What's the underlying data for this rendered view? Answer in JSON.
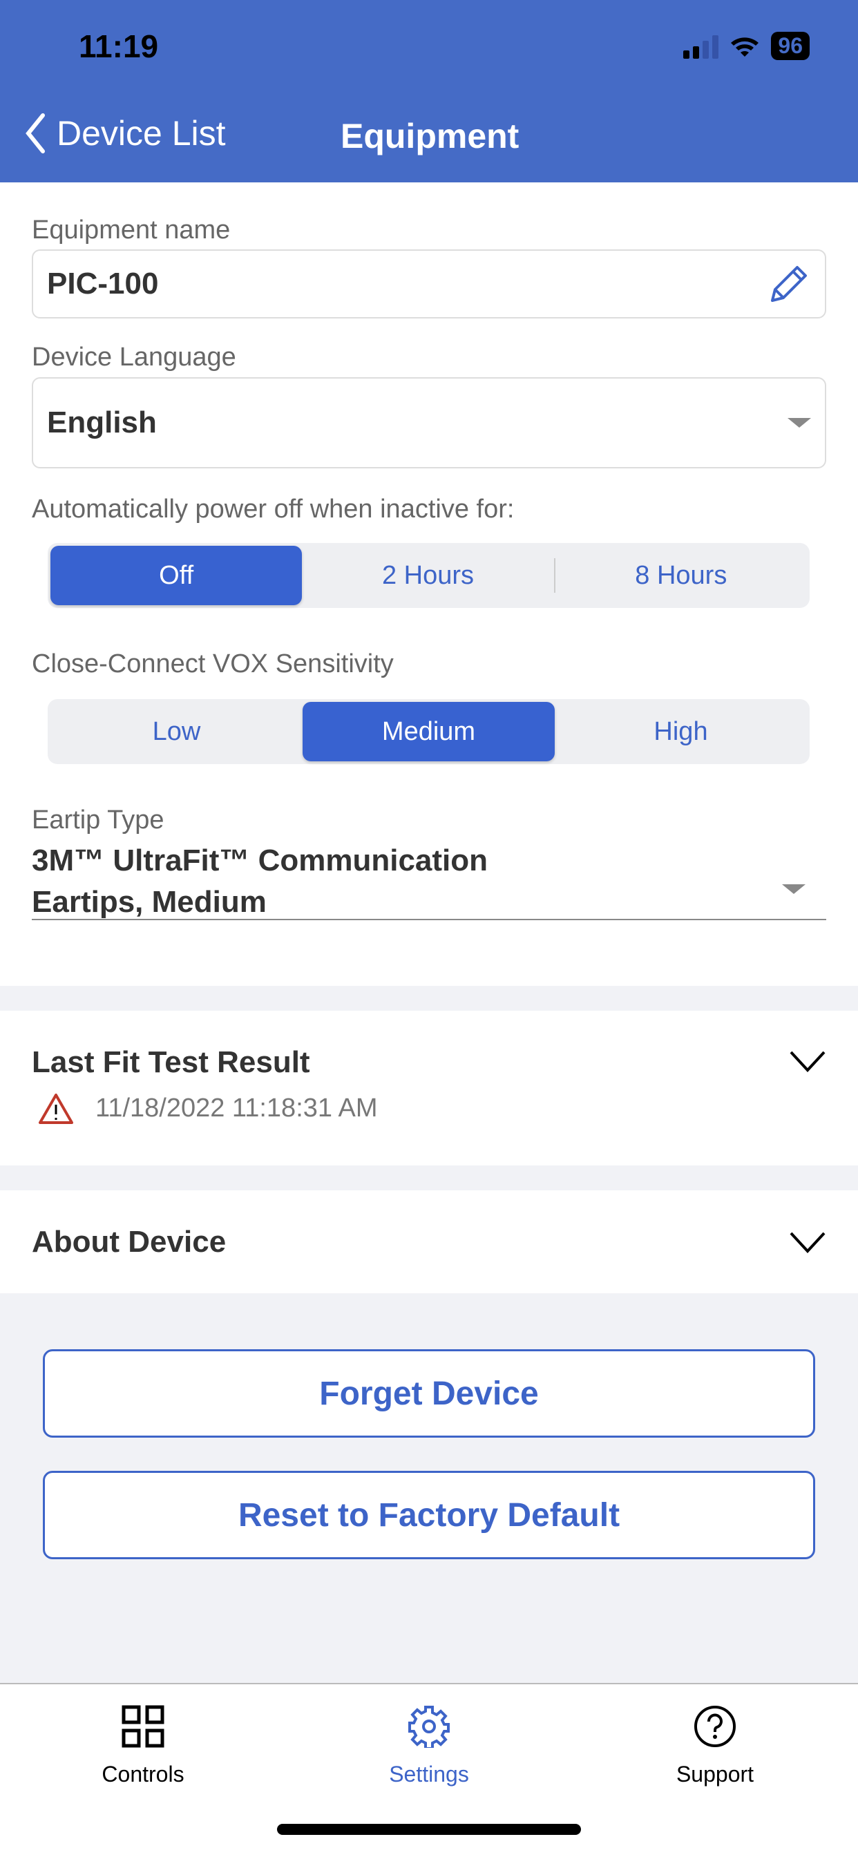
{
  "status_bar": {
    "time": "11:19",
    "battery": "96"
  },
  "nav": {
    "back_label": "Device List",
    "title": "Equipment"
  },
  "equipment_name": {
    "label": "Equipment name",
    "value": "PIC-100"
  },
  "device_language": {
    "label": "Device Language",
    "value": "English"
  },
  "auto_power_off": {
    "label": "Automatically power off when inactive for:",
    "options": [
      "Off",
      "2 Hours",
      "8 Hours"
    ],
    "selected": "Off"
  },
  "vox_sensitivity": {
    "label": "Close-Connect VOX Sensitivity",
    "options": [
      "Low",
      "Medium",
      "High"
    ],
    "selected": "Medium"
  },
  "eartip": {
    "label": "Eartip Type",
    "value_line1": "3M™ UltraFit™ Communication",
    "value_line2": "Eartips, Medium"
  },
  "last_fit": {
    "title": "Last Fit Test Result",
    "timestamp": "11/18/2022 11:18:31 AM"
  },
  "about": {
    "title": "About Device"
  },
  "buttons": {
    "forget": "Forget Device",
    "reset": "Reset to Factory Default"
  },
  "tabs": [
    {
      "label": "Controls",
      "icon": "grid-icon"
    },
    {
      "label": "Settings",
      "icon": "gear-icon",
      "active": true
    },
    {
      "label": "Support",
      "icon": "help-circle-icon"
    }
  ],
  "colors": {
    "header": "#456bc6",
    "accent": "#3862d0",
    "warning": "#c0392b"
  }
}
